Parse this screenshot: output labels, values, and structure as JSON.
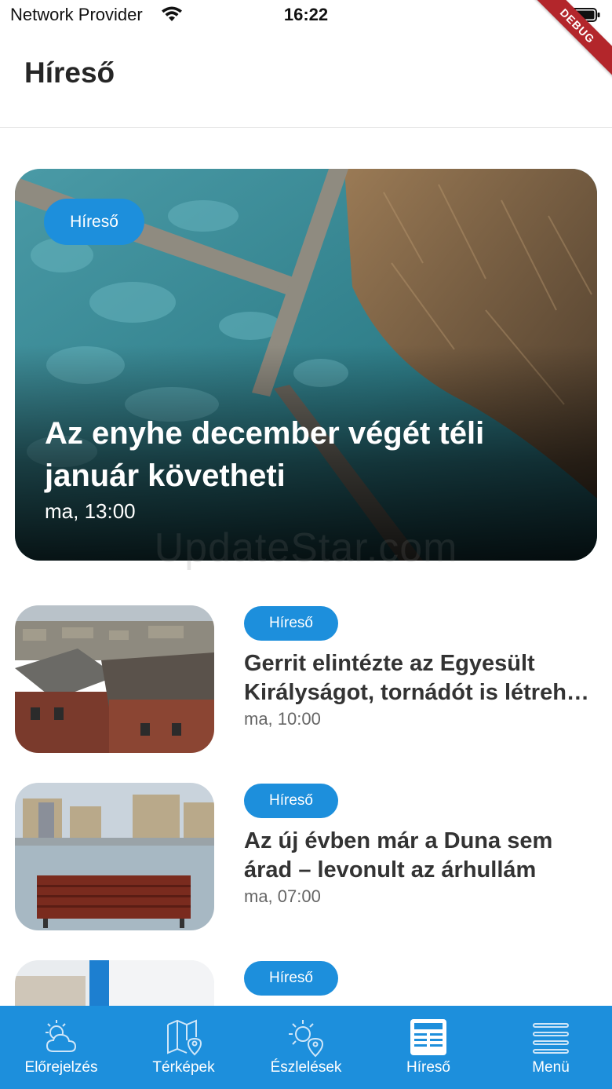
{
  "status_bar": {
    "carrier": "Network Provider",
    "time": "16:22",
    "debug_label": "DEBUG"
  },
  "header": {
    "title": "Híreső"
  },
  "hero": {
    "category": "Híreső",
    "title": "Az enyhe december végét téli január követheti",
    "time": "ma, 13:00"
  },
  "watermark": "UpdateStar.com",
  "articles": [
    {
      "category": "Híreső",
      "title_line1": "Gerrit elintézte az Egyesült",
      "title_line2": "Királyságot, tornádót is létrehozott",
      "time": "ma, 10:00"
    },
    {
      "category": "Híreső",
      "title_line1": "Az új évben már a Duna sem",
      "title_line2": "árad – levonult az árhullám",
      "time": "ma, 07:00"
    },
    {
      "category": "Híreső"
    }
  ],
  "nav": {
    "items": [
      {
        "label": "Előrejelzés",
        "icon": "cloud-sun-icon"
      },
      {
        "label": "Térképek",
        "icon": "map-pin-icon"
      },
      {
        "label": "Észlelések",
        "icon": "sun-pin-icon"
      },
      {
        "label": "Híreső",
        "icon": "newspaper-icon"
      },
      {
        "label": "Menü",
        "icon": "menu-icon"
      }
    ],
    "active_index": 3
  },
  "colors": {
    "accent": "#1d8fdc",
    "debug_ribbon": "#b3262b"
  }
}
